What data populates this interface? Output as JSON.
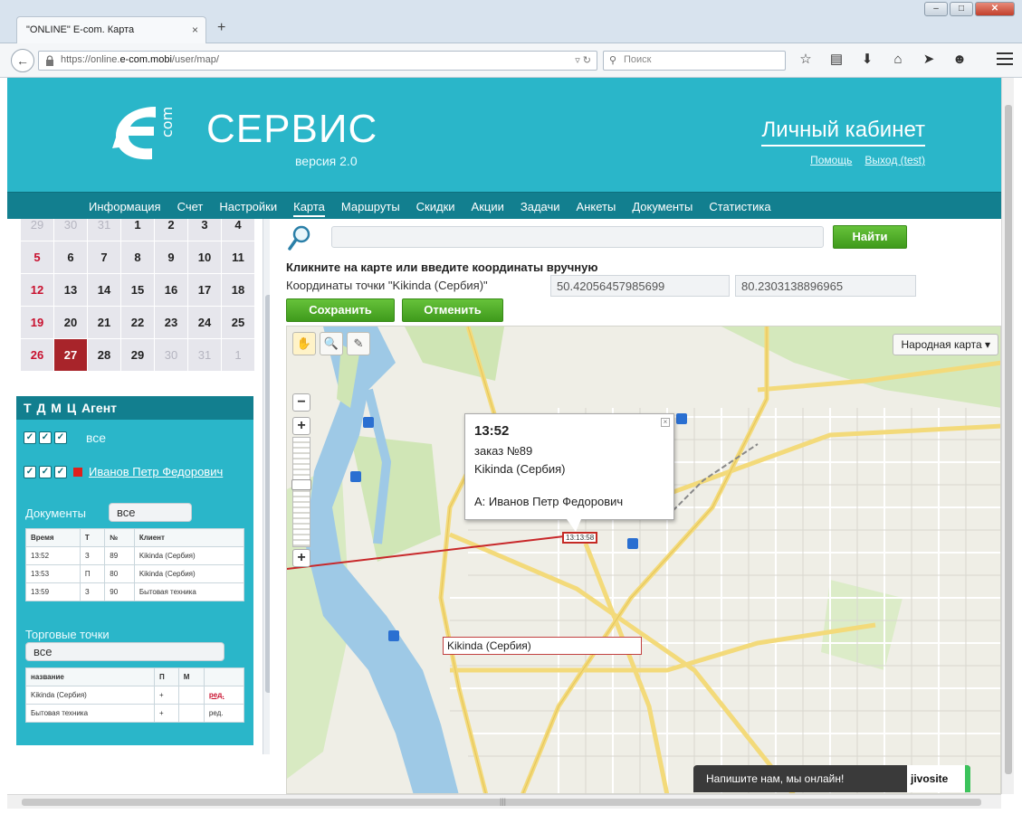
{
  "browser": {
    "tab_title": "\"ONLINE\" E-com. Карта",
    "tab_close": "×",
    "new_tab": "+",
    "url_prefix": "https://online.",
    "url_host": "e-com.mobi",
    "url_path": "/user/map/",
    "search_placeholder": "Поиск"
  },
  "header": {
    "brand": "СЕРВИС",
    "version": "версия 2.0",
    "cabinet": "Личный кабинет",
    "help": "Помощь",
    "logout": "Выход (test)",
    "colors": {
      "accent": "#2ab6c9",
      "menu": "#127f8f"
    }
  },
  "menu": [
    "Информация",
    "Счет",
    "Настройки",
    "Карта",
    "Маршруты",
    "Скидки",
    "Акции",
    "Задачи",
    "Анкеты",
    "Документы",
    "Статистика"
  ],
  "calendar": {
    "rows": [
      [
        "29",
        "30",
        "31",
        "1",
        "2",
        "3",
        "4"
      ],
      [
        "5",
        "6",
        "7",
        "8",
        "9",
        "10",
        "11"
      ],
      [
        "12",
        "13",
        "14",
        "15",
        "16",
        "17",
        "18"
      ],
      [
        "19",
        "20",
        "21",
        "22",
        "23",
        "24",
        "25"
      ],
      [
        "26",
        "27",
        "28",
        "29",
        "30",
        "31",
        "1"
      ]
    ],
    "today": "27"
  },
  "agents": {
    "header": "Т Д М Ц Агент",
    "all_label": "все",
    "agent_name": "Иванов Петр Федорович",
    "documents_label": "Документы",
    "documents_filter": "все",
    "doc_columns": [
      "Время",
      "Т",
      "№",
      "Клиент"
    ],
    "doc_rows": [
      [
        "13:52",
        "З",
        "89",
        "Kikinda (Сербия)"
      ],
      [
        "13:53",
        "П",
        "80",
        "Kikinda (Сербия)"
      ],
      [
        "13:59",
        "З",
        "90",
        "Бытовая техника"
      ]
    ],
    "points_label": "Торговые точки",
    "points_filter": "все",
    "point_columns": [
      "название",
      "П",
      "М",
      ""
    ],
    "point_rows": [
      [
        "Kikinda (Сербия)",
        "+",
        "",
        "ред."
      ],
      [
        "Бытовая техника",
        "+",
        "",
        "ред."
      ]
    ]
  },
  "map_panel": {
    "find_button": "Найти",
    "instruction": "Кликните на карте или введите координаты вручную",
    "coord_label": "Координаты точки \"Kikinda (Сербия)\"",
    "lat": "50.42056457985699",
    "lon": "80.2303138896965",
    "save_button": "Сохранить",
    "cancel_button": "Отменить",
    "map_type": "Народная карта ▾",
    "balloon": {
      "time": "13:52",
      "order": "заказ №89",
      "place": "Kikinda (Сербия)",
      "agent": "А: Иванов Петр Федорович"
    },
    "marker_time": "13:13:58",
    "place_label": "Kikinda (Сербия)"
  },
  "chat": {
    "text": "Напишите нам, мы онлайн!",
    "logo": "jivosite"
  }
}
